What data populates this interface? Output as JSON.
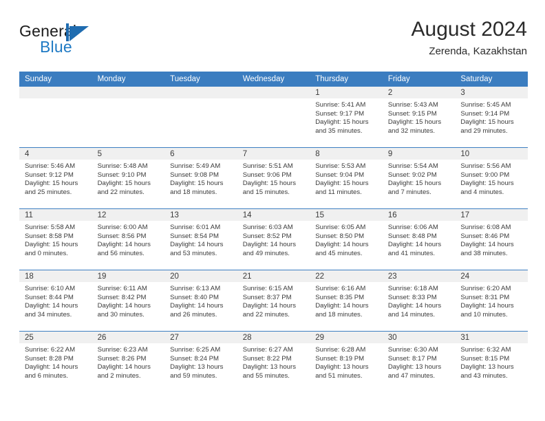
{
  "brand": {
    "name_top": "General",
    "name_bottom": "Blue",
    "accent_color": "#1f6cb0"
  },
  "header": {
    "title": "August 2024",
    "subtitle": "Zerenda, Kazakhstan"
  },
  "theme": {
    "header_blue": "#3b7dc0",
    "band_gray": "#f0f0f0",
    "text": "#3a3a3a"
  },
  "calendar": {
    "weekday_headers": [
      "Sunday",
      "Monday",
      "Tuesday",
      "Wednesday",
      "Thursday",
      "Friday",
      "Saturday"
    ],
    "weeks": [
      [
        {
          "day": "",
          "sunrise": "",
          "sunset": "",
          "daylight": "",
          "empty": true
        },
        {
          "day": "",
          "sunrise": "",
          "sunset": "",
          "daylight": "",
          "empty": true
        },
        {
          "day": "",
          "sunrise": "",
          "sunset": "",
          "daylight": "",
          "empty": true
        },
        {
          "day": "",
          "sunrise": "",
          "sunset": "",
          "daylight": "",
          "empty": true
        },
        {
          "day": "1",
          "sunrise": "Sunrise: 5:41 AM",
          "sunset": "Sunset: 9:17 PM",
          "daylight": "Daylight: 15 hours and 35 minutes."
        },
        {
          "day": "2",
          "sunrise": "Sunrise: 5:43 AM",
          "sunset": "Sunset: 9:15 PM",
          "daylight": "Daylight: 15 hours and 32 minutes."
        },
        {
          "day": "3",
          "sunrise": "Sunrise: 5:45 AM",
          "sunset": "Sunset: 9:14 PM",
          "daylight": "Daylight: 15 hours and 29 minutes."
        }
      ],
      [
        {
          "day": "4",
          "sunrise": "Sunrise: 5:46 AM",
          "sunset": "Sunset: 9:12 PM",
          "daylight": "Daylight: 15 hours and 25 minutes."
        },
        {
          "day": "5",
          "sunrise": "Sunrise: 5:48 AM",
          "sunset": "Sunset: 9:10 PM",
          "daylight": "Daylight: 15 hours and 22 minutes."
        },
        {
          "day": "6",
          "sunrise": "Sunrise: 5:49 AM",
          "sunset": "Sunset: 9:08 PM",
          "daylight": "Daylight: 15 hours and 18 minutes."
        },
        {
          "day": "7",
          "sunrise": "Sunrise: 5:51 AM",
          "sunset": "Sunset: 9:06 PM",
          "daylight": "Daylight: 15 hours and 15 minutes."
        },
        {
          "day": "8",
          "sunrise": "Sunrise: 5:53 AM",
          "sunset": "Sunset: 9:04 PM",
          "daylight": "Daylight: 15 hours and 11 minutes."
        },
        {
          "day": "9",
          "sunrise": "Sunrise: 5:54 AM",
          "sunset": "Sunset: 9:02 PM",
          "daylight": "Daylight: 15 hours and 7 minutes."
        },
        {
          "day": "10",
          "sunrise": "Sunrise: 5:56 AM",
          "sunset": "Sunset: 9:00 PM",
          "daylight": "Daylight: 15 hours and 4 minutes."
        }
      ],
      [
        {
          "day": "11",
          "sunrise": "Sunrise: 5:58 AM",
          "sunset": "Sunset: 8:58 PM",
          "daylight": "Daylight: 15 hours and 0 minutes."
        },
        {
          "day": "12",
          "sunrise": "Sunrise: 6:00 AM",
          "sunset": "Sunset: 8:56 PM",
          "daylight": "Daylight: 14 hours and 56 minutes."
        },
        {
          "day": "13",
          "sunrise": "Sunrise: 6:01 AM",
          "sunset": "Sunset: 8:54 PM",
          "daylight": "Daylight: 14 hours and 53 minutes."
        },
        {
          "day": "14",
          "sunrise": "Sunrise: 6:03 AM",
          "sunset": "Sunset: 8:52 PM",
          "daylight": "Daylight: 14 hours and 49 minutes."
        },
        {
          "day": "15",
          "sunrise": "Sunrise: 6:05 AM",
          "sunset": "Sunset: 8:50 PM",
          "daylight": "Daylight: 14 hours and 45 minutes."
        },
        {
          "day": "16",
          "sunrise": "Sunrise: 6:06 AM",
          "sunset": "Sunset: 8:48 PM",
          "daylight": "Daylight: 14 hours and 41 minutes."
        },
        {
          "day": "17",
          "sunrise": "Sunrise: 6:08 AM",
          "sunset": "Sunset: 8:46 PM",
          "daylight": "Daylight: 14 hours and 38 minutes."
        }
      ],
      [
        {
          "day": "18",
          "sunrise": "Sunrise: 6:10 AM",
          "sunset": "Sunset: 8:44 PM",
          "daylight": "Daylight: 14 hours and 34 minutes."
        },
        {
          "day": "19",
          "sunrise": "Sunrise: 6:11 AM",
          "sunset": "Sunset: 8:42 PM",
          "daylight": "Daylight: 14 hours and 30 minutes."
        },
        {
          "day": "20",
          "sunrise": "Sunrise: 6:13 AM",
          "sunset": "Sunset: 8:40 PM",
          "daylight": "Daylight: 14 hours and 26 minutes."
        },
        {
          "day": "21",
          "sunrise": "Sunrise: 6:15 AM",
          "sunset": "Sunset: 8:37 PM",
          "daylight": "Daylight: 14 hours and 22 minutes."
        },
        {
          "day": "22",
          "sunrise": "Sunrise: 6:16 AM",
          "sunset": "Sunset: 8:35 PM",
          "daylight": "Daylight: 14 hours and 18 minutes."
        },
        {
          "day": "23",
          "sunrise": "Sunrise: 6:18 AM",
          "sunset": "Sunset: 8:33 PM",
          "daylight": "Daylight: 14 hours and 14 minutes."
        },
        {
          "day": "24",
          "sunrise": "Sunrise: 6:20 AM",
          "sunset": "Sunset: 8:31 PM",
          "daylight": "Daylight: 14 hours and 10 minutes."
        }
      ],
      [
        {
          "day": "25",
          "sunrise": "Sunrise: 6:22 AM",
          "sunset": "Sunset: 8:28 PM",
          "daylight": "Daylight: 14 hours and 6 minutes."
        },
        {
          "day": "26",
          "sunrise": "Sunrise: 6:23 AM",
          "sunset": "Sunset: 8:26 PM",
          "daylight": "Daylight: 14 hours and 2 minutes."
        },
        {
          "day": "27",
          "sunrise": "Sunrise: 6:25 AM",
          "sunset": "Sunset: 8:24 PM",
          "daylight": "Daylight: 13 hours and 59 minutes."
        },
        {
          "day": "28",
          "sunrise": "Sunrise: 6:27 AM",
          "sunset": "Sunset: 8:22 PM",
          "daylight": "Daylight: 13 hours and 55 minutes."
        },
        {
          "day": "29",
          "sunrise": "Sunrise: 6:28 AM",
          "sunset": "Sunset: 8:19 PM",
          "daylight": "Daylight: 13 hours and 51 minutes."
        },
        {
          "day": "30",
          "sunrise": "Sunrise: 6:30 AM",
          "sunset": "Sunset: 8:17 PM",
          "daylight": "Daylight: 13 hours and 47 minutes."
        },
        {
          "day": "31",
          "sunrise": "Sunrise: 6:32 AM",
          "sunset": "Sunset: 8:15 PM",
          "daylight": "Daylight: 13 hours and 43 minutes."
        }
      ]
    ]
  }
}
